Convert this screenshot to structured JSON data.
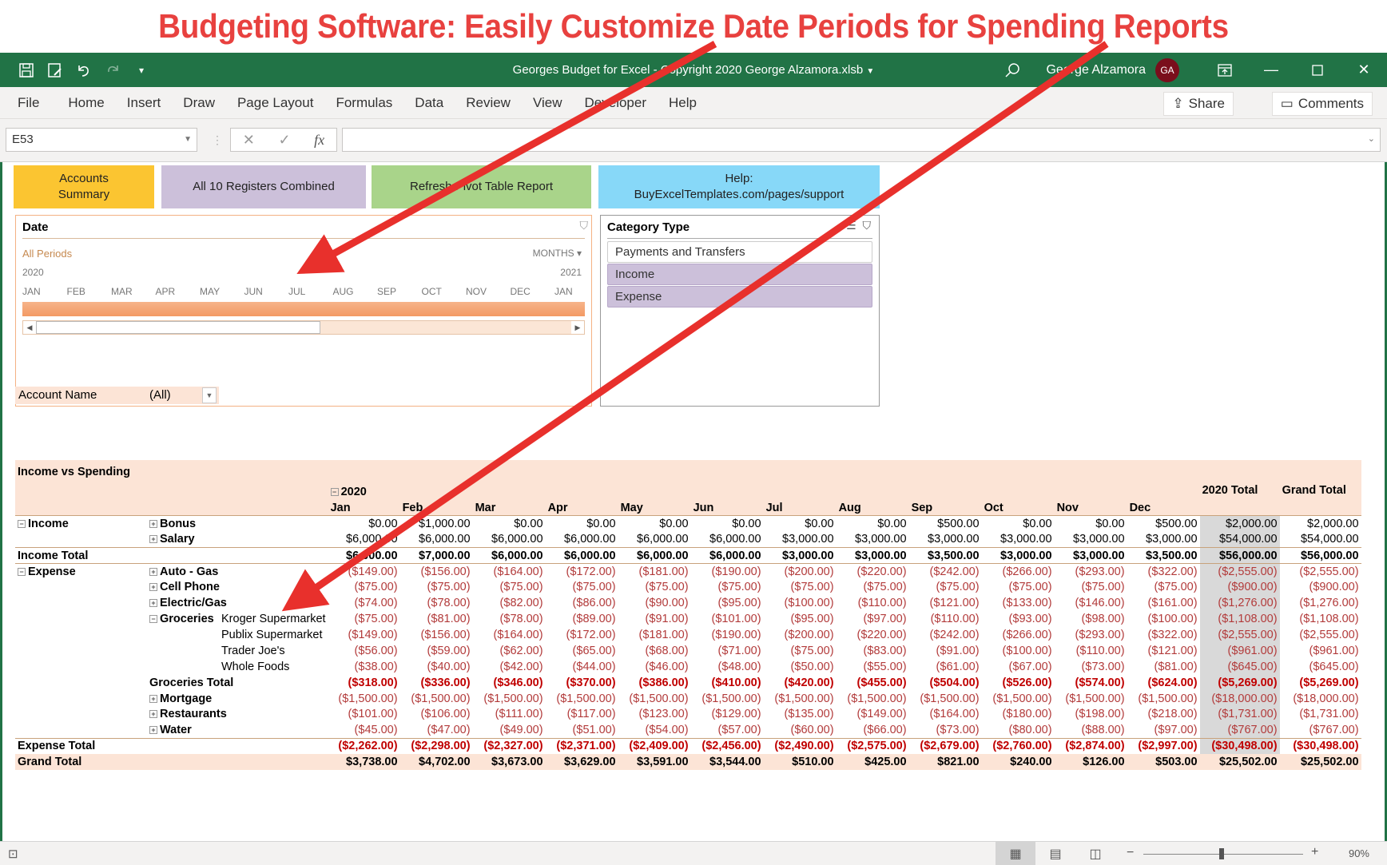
{
  "banner": {
    "title": "Budgeting Software: Easily Customize Date Periods for Spending Reports",
    "color": "#e8413f"
  },
  "titlebar": {
    "doc_title": "Georges Budget for Excel - Copyright 2020 George Alzamora.xlsb",
    "user_name": "George Alzamora",
    "avatar_initials": "GA",
    "accent": "#217346",
    "icons": [
      "save-icon",
      "autosave-icon",
      "undo-icon",
      "redo-icon",
      "customize-qat-icon",
      "search-icon",
      "ribbon-display-icon",
      "minimize-icon",
      "maximize-icon",
      "close-icon"
    ]
  },
  "menu": {
    "items": [
      "File",
      "Home",
      "Insert",
      "Draw",
      "Page Layout",
      "Formulas",
      "Data",
      "Review",
      "View",
      "Developer",
      "Help"
    ],
    "share_label": "Share",
    "comments_label": "Comments"
  },
  "formula_bar": {
    "name_box": "E53",
    "formula": "",
    "fx_label": "fx"
  },
  "buttons": {
    "accounts_summary": "Accounts Summary",
    "registers": "All 10 Registers Combined",
    "refresh": "Refresh Pivot Table Report",
    "help_line1": "Help:",
    "help_line2": "BuyExcelTemplates.com/pages/support"
  },
  "timeline": {
    "title": "Date",
    "selection": "All Periods",
    "level": "MONTHS",
    "year_start": "2020",
    "year_end": "2021",
    "months": [
      "JAN",
      "FEB",
      "MAR",
      "APR",
      "MAY",
      "JUN",
      "JUL",
      "AUG",
      "SEP",
      "OCT",
      "NOV",
      "DEC",
      "JAN"
    ]
  },
  "slicer": {
    "title": "Category Type",
    "items": [
      {
        "label": "Payments and Transfers",
        "selected": false
      },
      {
        "label": "Income",
        "selected": true
      },
      {
        "label": "Expense",
        "selected": true
      }
    ]
  },
  "filter": {
    "label": "Account Name",
    "value": "(All)"
  },
  "pivot": {
    "title": "Income vs Spending",
    "year": "2020",
    "months": [
      "Jan",
      "Feb",
      "Mar",
      "Apr",
      "May",
      "Jun",
      "Jul",
      "Aug",
      "Sep",
      "Oct",
      "Nov",
      "Dec"
    ],
    "total_2020_label": "2020 Total",
    "grand_total_label": "Grand Total",
    "rows": [
      {
        "group": "Income",
        "label": "Bonus",
        "kind": "item",
        "expand": "+",
        "values": [
          "$0.00",
          "$1,000.00",
          "$0.00",
          "$0.00",
          "$0.00",
          "$0.00",
          "$0.00",
          "$0.00",
          "$500.00",
          "$0.00",
          "$0.00",
          "$500.00",
          "$2,000.00",
          "$2,000.00"
        ]
      },
      {
        "group": "",
        "label": "Salary",
        "kind": "item",
        "expand": "+",
        "values": [
          "$6,000.00",
          "$6,000.00",
          "$6,000.00",
          "$6,000.00",
          "$6,000.00",
          "$6,000.00",
          "$3,000.00",
          "$3,000.00",
          "$3,000.00",
          "$3,000.00",
          "$3,000.00",
          "$3,000.00",
          "$54,000.00",
          "$54,000.00"
        ]
      },
      {
        "group": "Income Total",
        "label": "",
        "kind": "total",
        "values": [
          "$6,000.00",
          "$7,000.00",
          "$6,000.00",
          "$6,000.00",
          "$6,000.00",
          "$6,000.00",
          "$3,000.00",
          "$3,000.00",
          "$3,500.00",
          "$3,000.00",
          "$3,000.00",
          "$3,500.00",
          "$56,000.00",
          "$56,000.00"
        ]
      },
      {
        "group": "Expense",
        "label": "Auto - Gas",
        "kind": "negitem",
        "expand": "+",
        "values": [
          "($149.00)",
          "($156.00)",
          "($164.00)",
          "($172.00)",
          "($181.00)",
          "($190.00)",
          "($200.00)",
          "($220.00)",
          "($242.00)",
          "($266.00)",
          "($293.00)",
          "($322.00)",
          "($2,555.00)",
          "($2,555.00)"
        ]
      },
      {
        "group": "",
        "label": "Cell Phone",
        "kind": "negitem",
        "expand": "+",
        "values": [
          "($75.00)",
          "($75.00)",
          "($75.00)",
          "($75.00)",
          "($75.00)",
          "($75.00)",
          "($75.00)",
          "($75.00)",
          "($75.00)",
          "($75.00)",
          "($75.00)",
          "($75.00)",
          "($900.00)",
          "($900.00)"
        ]
      },
      {
        "group": "",
        "label": "Electric/Gas",
        "kind": "negitem",
        "expand": "+",
        "values": [
          "($74.00)",
          "($78.00)",
          "($82.00)",
          "($86.00)",
          "($90.00)",
          "($95.00)",
          "($100.00)",
          "($110.00)",
          "($121.00)",
          "($133.00)",
          "($146.00)",
          "($161.00)",
          "($1,276.00)",
          "($1,276.00)"
        ]
      },
      {
        "group": "",
        "label": "Groceries",
        "sub": "Kroger Supermarket",
        "kind": "negitem",
        "expand": "-",
        "values": [
          "($75.00)",
          "($81.00)",
          "($78.00)",
          "($89.00)",
          "($91.00)",
          "($101.00)",
          "($95.00)",
          "($97.00)",
          "($110.00)",
          "($93.00)",
          "($98.00)",
          "($100.00)",
          "($1,108.00)",
          "($1,108.00)"
        ]
      },
      {
        "group": "",
        "label": "",
        "sub": "Publix Supermarket",
        "kind": "negitem",
        "values": [
          "($149.00)",
          "($156.00)",
          "($164.00)",
          "($172.00)",
          "($181.00)",
          "($190.00)",
          "($200.00)",
          "($220.00)",
          "($242.00)",
          "($266.00)",
          "($293.00)",
          "($322.00)",
          "($2,555.00)",
          "($2,555.00)"
        ]
      },
      {
        "group": "",
        "label": "",
        "sub": "Trader Joe's",
        "kind": "negitem",
        "values": [
          "($56.00)",
          "($59.00)",
          "($62.00)",
          "($65.00)",
          "($68.00)",
          "($71.00)",
          "($75.00)",
          "($83.00)",
          "($91.00)",
          "($100.00)",
          "($110.00)",
          "($121.00)",
          "($961.00)",
          "($961.00)"
        ]
      },
      {
        "group": "",
        "label": "",
        "sub": "Whole Foods",
        "kind": "negitem",
        "values": [
          "($38.00)",
          "($40.00)",
          "($42.00)",
          "($44.00)",
          "($46.00)",
          "($48.00)",
          "($50.00)",
          "($55.00)",
          "($61.00)",
          "($67.00)",
          "($73.00)",
          "($81.00)",
          "($645.00)",
          "($645.00)"
        ]
      },
      {
        "group": "",
        "label": "Groceries Total",
        "kind": "subtotal",
        "values": [
          "($318.00)",
          "($336.00)",
          "($346.00)",
          "($370.00)",
          "($386.00)",
          "($410.00)",
          "($420.00)",
          "($455.00)",
          "($504.00)",
          "($526.00)",
          "($574.00)",
          "($624.00)",
          "($5,269.00)",
          "($5,269.00)"
        ]
      },
      {
        "group": "",
        "label": "Mortgage",
        "kind": "negitem",
        "expand": "+",
        "values": [
          "($1,500.00)",
          "($1,500.00)",
          "($1,500.00)",
          "($1,500.00)",
          "($1,500.00)",
          "($1,500.00)",
          "($1,500.00)",
          "($1,500.00)",
          "($1,500.00)",
          "($1,500.00)",
          "($1,500.00)",
          "($1,500.00)",
          "($18,000.00)",
          "($18,000.00)"
        ]
      },
      {
        "group": "",
        "label": "Restaurants",
        "kind": "negitem",
        "expand": "+",
        "values": [
          "($101.00)",
          "($106.00)",
          "($111.00)",
          "($117.00)",
          "($123.00)",
          "($129.00)",
          "($135.00)",
          "($149.00)",
          "($164.00)",
          "($180.00)",
          "($198.00)",
          "($218.00)",
          "($1,731.00)",
          "($1,731.00)"
        ]
      },
      {
        "group": "",
        "label": "Water",
        "kind": "negitem",
        "expand": "+",
        "values": [
          "($45.00)",
          "($47.00)",
          "($49.00)",
          "($51.00)",
          "($54.00)",
          "($57.00)",
          "($60.00)",
          "($66.00)",
          "($73.00)",
          "($80.00)",
          "($88.00)",
          "($97.00)",
          "($767.00)",
          "($767.00)"
        ]
      },
      {
        "group": "Expense Total",
        "label": "",
        "kind": "negtotal",
        "values": [
          "($2,262.00)",
          "($2,298.00)",
          "($2,327.00)",
          "($2,371.00)",
          "($2,409.00)",
          "($2,456.00)",
          "($2,490.00)",
          "($2,575.00)",
          "($2,679.00)",
          "($2,760.00)",
          "($2,874.00)",
          "($2,997.00)",
          "($30,498.00)",
          "($30,498.00)"
        ]
      },
      {
        "group": "Grand Total",
        "label": "",
        "kind": "grand",
        "values": [
          "$3,738.00",
          "$4,702.00",
          "$3,673.00",
          "$3,629.00",
          "$3,591.00",
          "$3,544.00",
          "$510.00",
          "$425.00",
          "$821.00",
          "$240.00",
          "$126.00",
          "$503.00",
          "$25,502.00",
          "$25,502.00"
        ]
      }
    ]
  },
  "statusbar": {
    "zoom_pct": "90%",
    "zoom_level": 0.9,
    "active_view": "Normal"
  }
}
